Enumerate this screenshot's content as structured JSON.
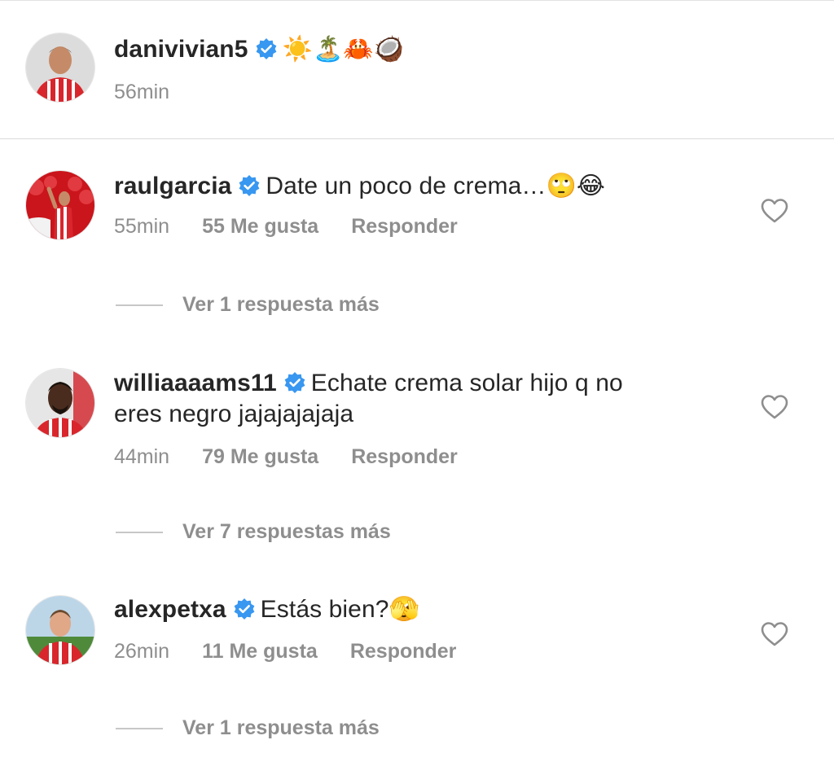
{
  "post": {
    "username": "danivivian5",
    "caption_emojis": "☀️🏝️🦀🥥",
    "time": "56min"
  },
  "comments": [
    {
      "username": "raulgarcia",
      "text": "Date un poco de crema…🙄😂",
      "text_line2": "",
      "time": "55min",
      "likes": "55 Me gusta",
      "reply_label": "Responder",
      "view_replies": "Ver 1 respuesta más"
    },
    {
      "username": "williaaaams11",
      "text": "Echate crema solar hijo q no",
      "text_line2": "eres negro jajajajajaja",
      "time": "44min",
      "likes": "79 Me gusta",
      "reply_label": "Responder",
      "view_replies": "Ver 7 respuestas más"
    },
    {
      "username": "alexpetxa",
      "text": "Estás bien?🫣",
      "text_line2": "",
      "time": "26min",
      "likes": "11 Me gusta",
      "reply_label": "Responder",
      "view_replies": "Ver 1 respuesta más"
    }
  ],
  "icons": {
    "verified": "verified-badge-icon",
    "like": "heart-icon"
  },
  "colors": {
    "verified_blue": "#3897f0",
    "meta_gray": "#8e8e8e",
    "text": "#262626",
    "jersey_red": "#d8262c"
  }
}
